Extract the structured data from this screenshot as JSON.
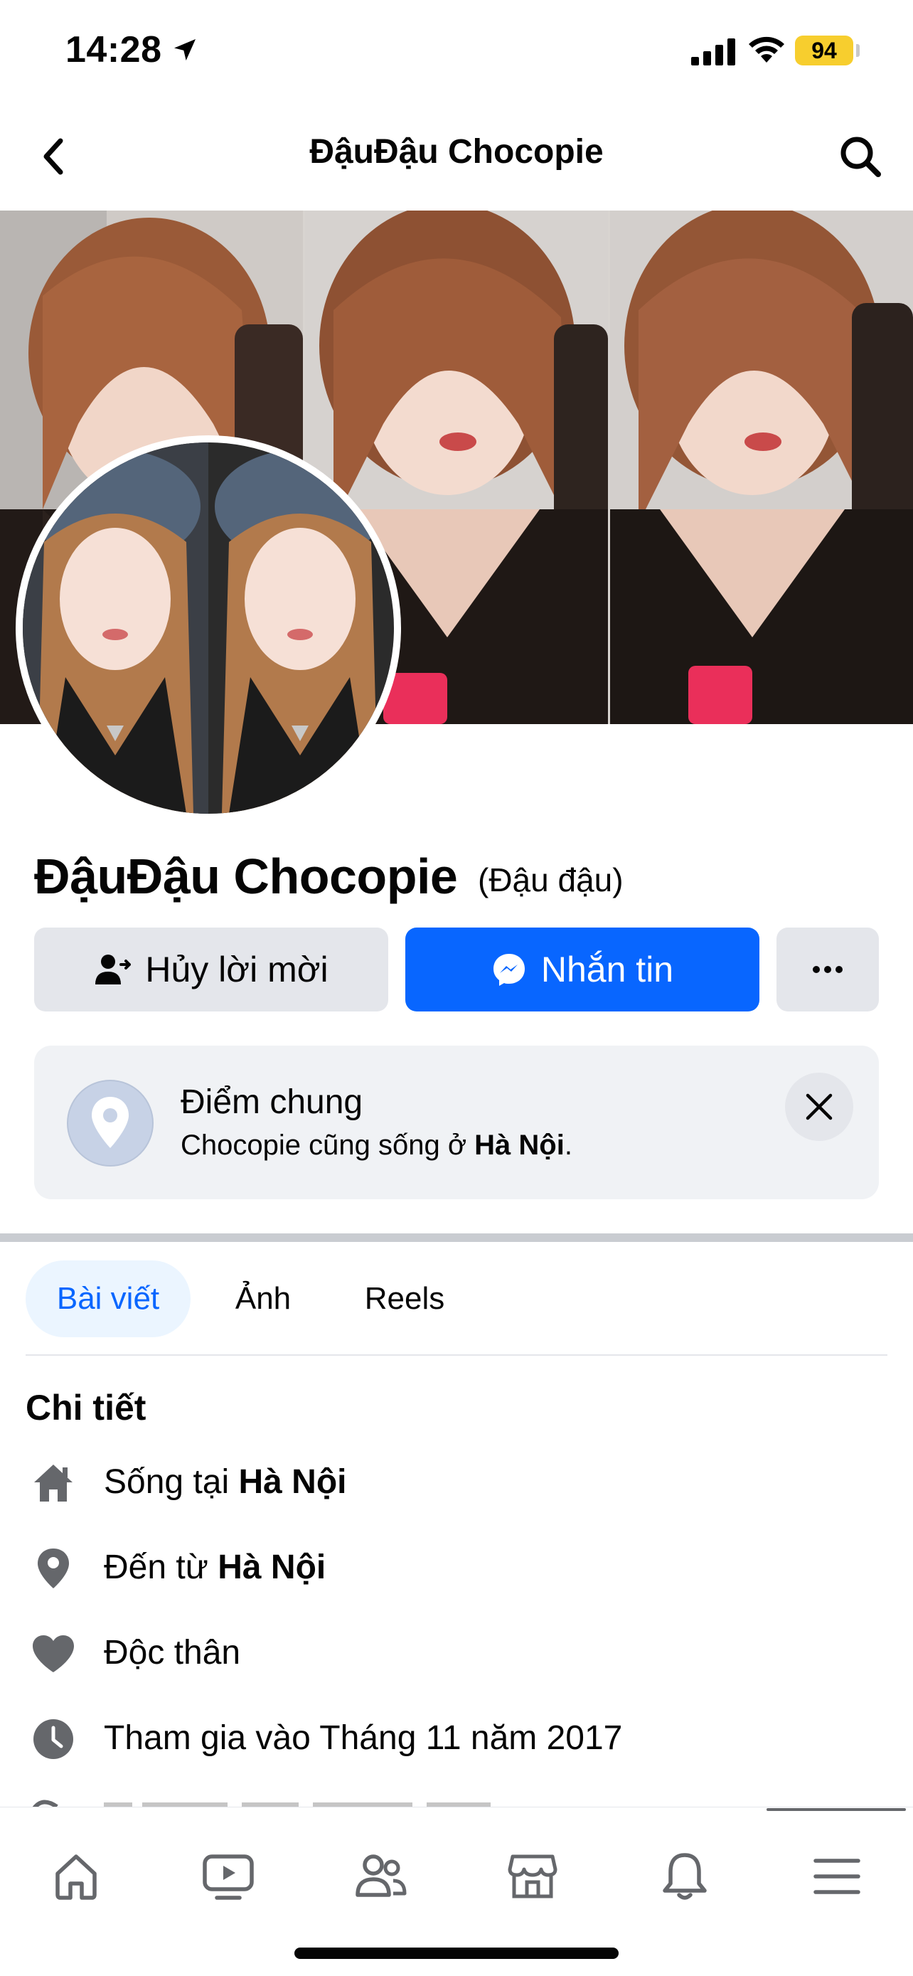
{
  "status_bar": {
    "time": "14:28",
    "battery": "94",
    "icons": [
      "location-arrow-icon",
      "cellular-signal-icon",
      "wifi-icon",
      "battery-icon"
    ]
  },
  "header": {
    "title": "ĐậuĐậu Chocopie",
    "icons": [
      "back-chevron-icon",
      "search-icon"
    ]
  },
  "profile": {
    "name": "ĐậuĐậu Chocopie",
    "alternate_name": "(Đậu đậu)"
  },
  "actions": {
    "cancel_request_label": "Hủy lời mời",
    "message_label": "Nhắn tin",
    "more_icon": "more-dots-icon",
    "message_color": "#0866ff"
  },
  "mutual": {
    "title": "Điểm chung",
    "text_prefix": "Chocopie cũng sống ở ",
    "text_place": "Hà Nội",
    "text_suffix": "."
  },
  "tabs": [
    {
      "label": "Bài viết",
      "active": true
    },
    {
      "label": "Ảnh",
      "active": false
    },
    {
      "label": "Reels",
      "active": false
    }
  ],
  "details": {
    "heading": "Chi tiết",
    "items": [
      {
        "icon": "home-icon",
        "prefix": "Sống tại ",
        "bold": "Hà Nội"
      },
      {
        "icon": "location-pin-icon",
        "prefix": "Đến từ ",
        "bold": "Hà Nội"
      },
      {
        "icon": "heart-icon",
        "prefix": "Độc thân",
        "bold": ""
      },
      {
        "icon": "clock-icon",
        "prefix": "Tham gia vào Tháng 11 năm 2017",
        "bold": ""
      }
    ]
  },
  "tab_bar": {
    "items": [
      "home-icon",
      "video-icon",
      "friends-icon",
      "marketplace-icon",
      "notifications-bell-icon",
      "menu-icon"
    ]
  }
}
